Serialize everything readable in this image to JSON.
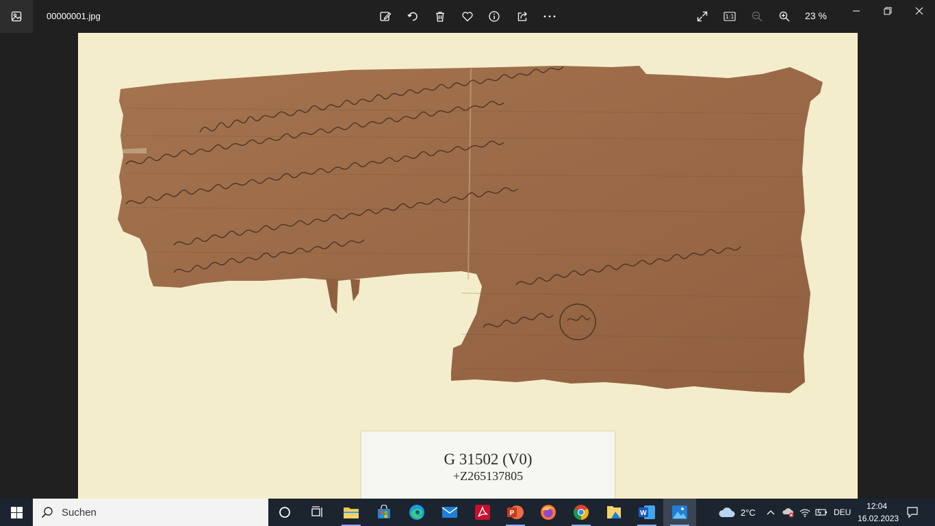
{
  "window": {
    "filename": "00000001.jpg",
    "zoom": "23 %",
    "actual_size_label": "1:1"
  },
  "toolbar": {
    "icons": [
      "edit-image-icon",
      "rotate-icon",
      "delete-icon",
      "favorite-icon",
      "info-icon",
      "share-icon",
      "more-icon"
    ]
  },
  "image": {
    "label_line1": "G 31502 (V0)",
    "label_line2": "+Z265137805"
  },
  "taskbar": {
    "search_placeholder": "Suchen",
    "weather": "2°C",
    "language": "DEU",
    "time": "12:04",
    "date": "16.02.2023"
  },
  "colors": {
    "titlebar": "#202020",
    "background_mat": "#f4edcb",
    "papyrus": "#9c6d4c",
    "taskbar": "#1c2430"
  }
}
